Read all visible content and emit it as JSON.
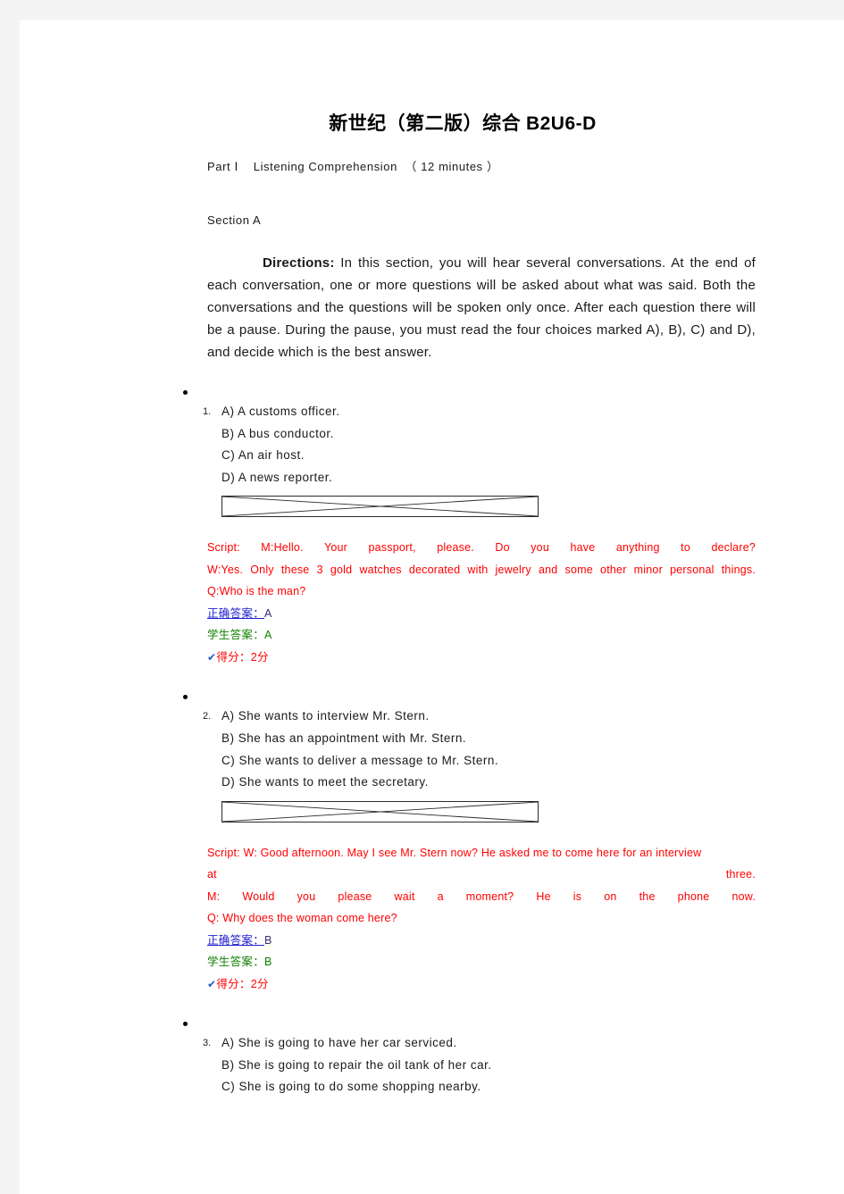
{
  "document": {
    "title_cn": "新世纪（第二版）综合 ",
    "title_code": "B2U6-D",
    "part_line": "Part Ⅰ    Listening Comprehension  （ 12 minutes ）",
    "section_label": "Section A",
    "directions_label": "Directions:",
    "directions_text": " In this section, you will hear several conversations. At the end of each conversation, one or more questions will be asked about what was said. Both the conversations and the questions will be spoken only once. After each question there will be a pause. During the pause, you must read the four choices marked A), B), C) and D), and decide which is the best answer."
  },
  "labels": {
    "correct_answer": "正确答案：",
    "student_answer": "学生答案：",
    "score_prefix": "得分：",
    "check_icon": "✔",
    "media_alt": "broken-audio-placeholder"
  },
  "questions": [
    {
      "number": "1.",
      "options": [
        "A) A customs officer.",
        "B) A bus conductor.",
        "C) An air host.",
        "D) A news reporter."
      ],
      "script_lines": [
        "Script:  M:Hello. Your passport, please. Do you have anything to declare?",
        "W:Yes. Only these 3 gold watches decorated with jewelry and some other minor personal things.",
        "Q:Who is the man?"
      ],
      "correct_value": "A",
      "student_value": "A",
      "student_text": "学生答案：A",
      "score": "2分"
    },
    {
      "number": "2.",
      "options": [
        "A) She wants to interview Mr. Stern.",
        "B) She has an appointment with Mr. Stern.",
        "C) She wants to deliver a message to Mr. Stern.",
        "D) She wants to meet the secretary."
      ],
      "script_lines": [
        "Script: W: Good afternoon. May I see Mr. Stern now? He asked me to come here for an interview",
        "at                                                                                                                                three.",
        "M: Would you please wait a moment? He is on the phone now.",
        "Q: Why does the woman come here?"
      ],
      "correct_value": "B",
      "student_value": "B",
      "student_text": "学生答案：B",
      "score": "2分"
    },
    {
      "number": "3.",
      "options": [
        "A) She is going to have her car serviced.",
        "B) She is going to repair the oil tank of her car.",
        "C) She is going to do some shopping nearby."
      ]
    }
  ],
  "colors": {
    "page_background": "#ffffff",
    "outer_background": "#f4f4f4",
    "script_red": "#ff0000",
    "correct_blue": "#2020d0",
    "student_green": "#108000",
    "check_blue": "#2458c8",
    "body_text": "#1a1a1a"
  }
}
